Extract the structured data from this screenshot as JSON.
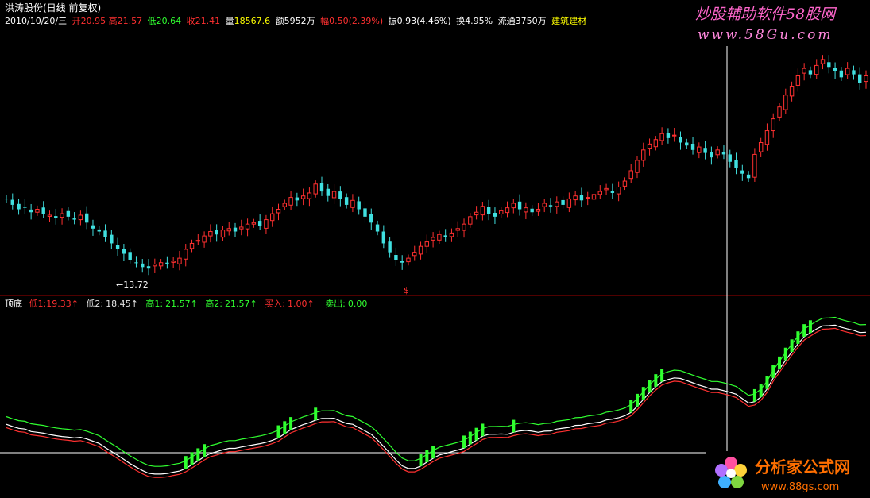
{
  "header": {
    "stock_title": "洪涛股份(日线 前复权)",
    "date": "2010/10/20/三",
    "open_label": "开",
    "open": "20.95",
    "high_label": "高",
    "high": "21.57",
    "low_label": "低",
    "low": "20.64",
    "close_label": "收",
    "close": "21.41",
    "volume_label": "量",
    "volume": "18567.6",
    "amount_label": "额",
    "amount": "5952万",
    "change_label": "幅",
    "change": "0.50(2.39%)",
    "amplitude_label": "振",
    "amplitude": "0.93(4.46%)",
    "turnover_label": "换",
    "turnover": "4.95%",
    "float_label": "流通",
    "float": "3750万",
    "industry": "建筑建材"
  },
  "watermark_top": {
    "line1": "炒股辅助软件58股网",
    "line2": "www.58Gu.com"
  },
  "watermark_bottom": {
    "line1": "分析家公式网",
    "line2": "www.88gs.com"
  },
  "price_chart": {
    "low_marker": "←13.72",
    "event_marker": "$"
  },
  "indicator": {
    "name": "顶底",
    "items": [
      {
        "label": "低1:",
        "value": "19.33",
        "arrow": "↑",
        "color": "#ff3030"
      },
      {
        "label": "低2:",
        "value": "18.45",
        "arrow": "↑",
        "color": "#e0e0e0"
      },
      {
        "label": "高1:",
        "value": "21.57",
        "arrow": "↑",
        "color": "#30ff30"
      },
      {
        "label": "高2:",
        "value": "21.57",
        "arrow": "↑",
        "color": "#30ff30"
      },
      {
        "label": "买入:",
        "value": "1.00",
        "arrow": "↑",
        "color": "#ff3030"
      },
      {
        "label": "卖出:",
        "value": "0.00",
        "arrow": "",
        "color": "#30ff30"
      }
    ]
  },
  "colors": {
    "up": "#ff3030",
    "down": "#40e0e0",
    "green": "#30ff30",
    "white": "#ffffff",
    "divider": "#a00000"
  },
  "chart_data": {
    "type": "candlestick",
    "title": "洪涛股份(日线 前复权)",
    "price_close": [
      18.6,
      18.2,
      17.9,
      18.0,
      17.7,
      17.9,
      17.6,
      17.5,
      17.3,
      17.6,
      17.4,
      17.2,
      17.5,
      17.0,
      16.6,
      16.4,
      16.0,
      15.6,
      15.2,
      14.9,
      14.5,
      14.3,
      14.0,
      13.9,
      14.2,
      14.3,
      14.2,
      14.4,
      14.6,
      15.2,
      15.6,
      15.8,
      16.1,
      16.4,
      16.2,
      16.5,
      16.6,
      16.4,
      16.7,
      16.9,
      17.0,
      16.8,
      17.2,
      17.6,
      17.9,
      18.3,
      18.7,
      18.5,
      18.8,
      19.0,
      19.6,
      19.1,
      18.8,
      19.1,
      18.6,
      18.2,
      18.5,
      17.9,
      17.4,
      17.0,
      16.4,
      15.6,
      15.0,
      14.5,
      14.3,
      14.6,
      15.0,
      15.4,
      15.7,
      16.0,
      16.2,
      16.0,
      16.3,
      16.6,
      16.9,
      17.4,
      17.7,
      18.1,
      17.6,
      17.4,
      17.8,
      18.0,
      18.3,
      17.9,
      18.0,
      17.7,
      17.9,
      18.3,
      18.1,
      18.4,
      18.2,
      18.6,
      18.8,
      18.5,
      18.7,
      18.9,
      19.1,
      19.3,
      19.0,
      19.4,
      19.8,
      20.5,
      21.2,
      21.9,
      22.3,
      22.6,
      23.0,
      22.7,
      22.9,
      22.4,
      22.2,
      21.9,
      22.1,
      21.7,
      21.4,
      21.9,
      21.6,
      21.1,
      20.7,
      20.3,
      20.0,
      21.6,
      22.4,
      23.2,
      24.0,
      24.8,
      25.6,
      26.2,
      26.9,
      27.4,
      27.0,
      27.6,
      28.0,
      27.5,
      27.2,
      26.8,
      27.4,
      27.0,
      26.4,
      26.9
    ],
    "indicator_series": [
      {
        "name": "低1",
        "color": "#ff3030"
      },
      {
        "name": "低2",
        "color": "#e0e0e0"
      },
      {
        "name": "高1",
        "color": "#30ff30"
      },
      {
        "name": "高2",
        "color": "#30ff30"
      }
    ],
    "markers": {
      "low": 13.72
    }
  }
}
